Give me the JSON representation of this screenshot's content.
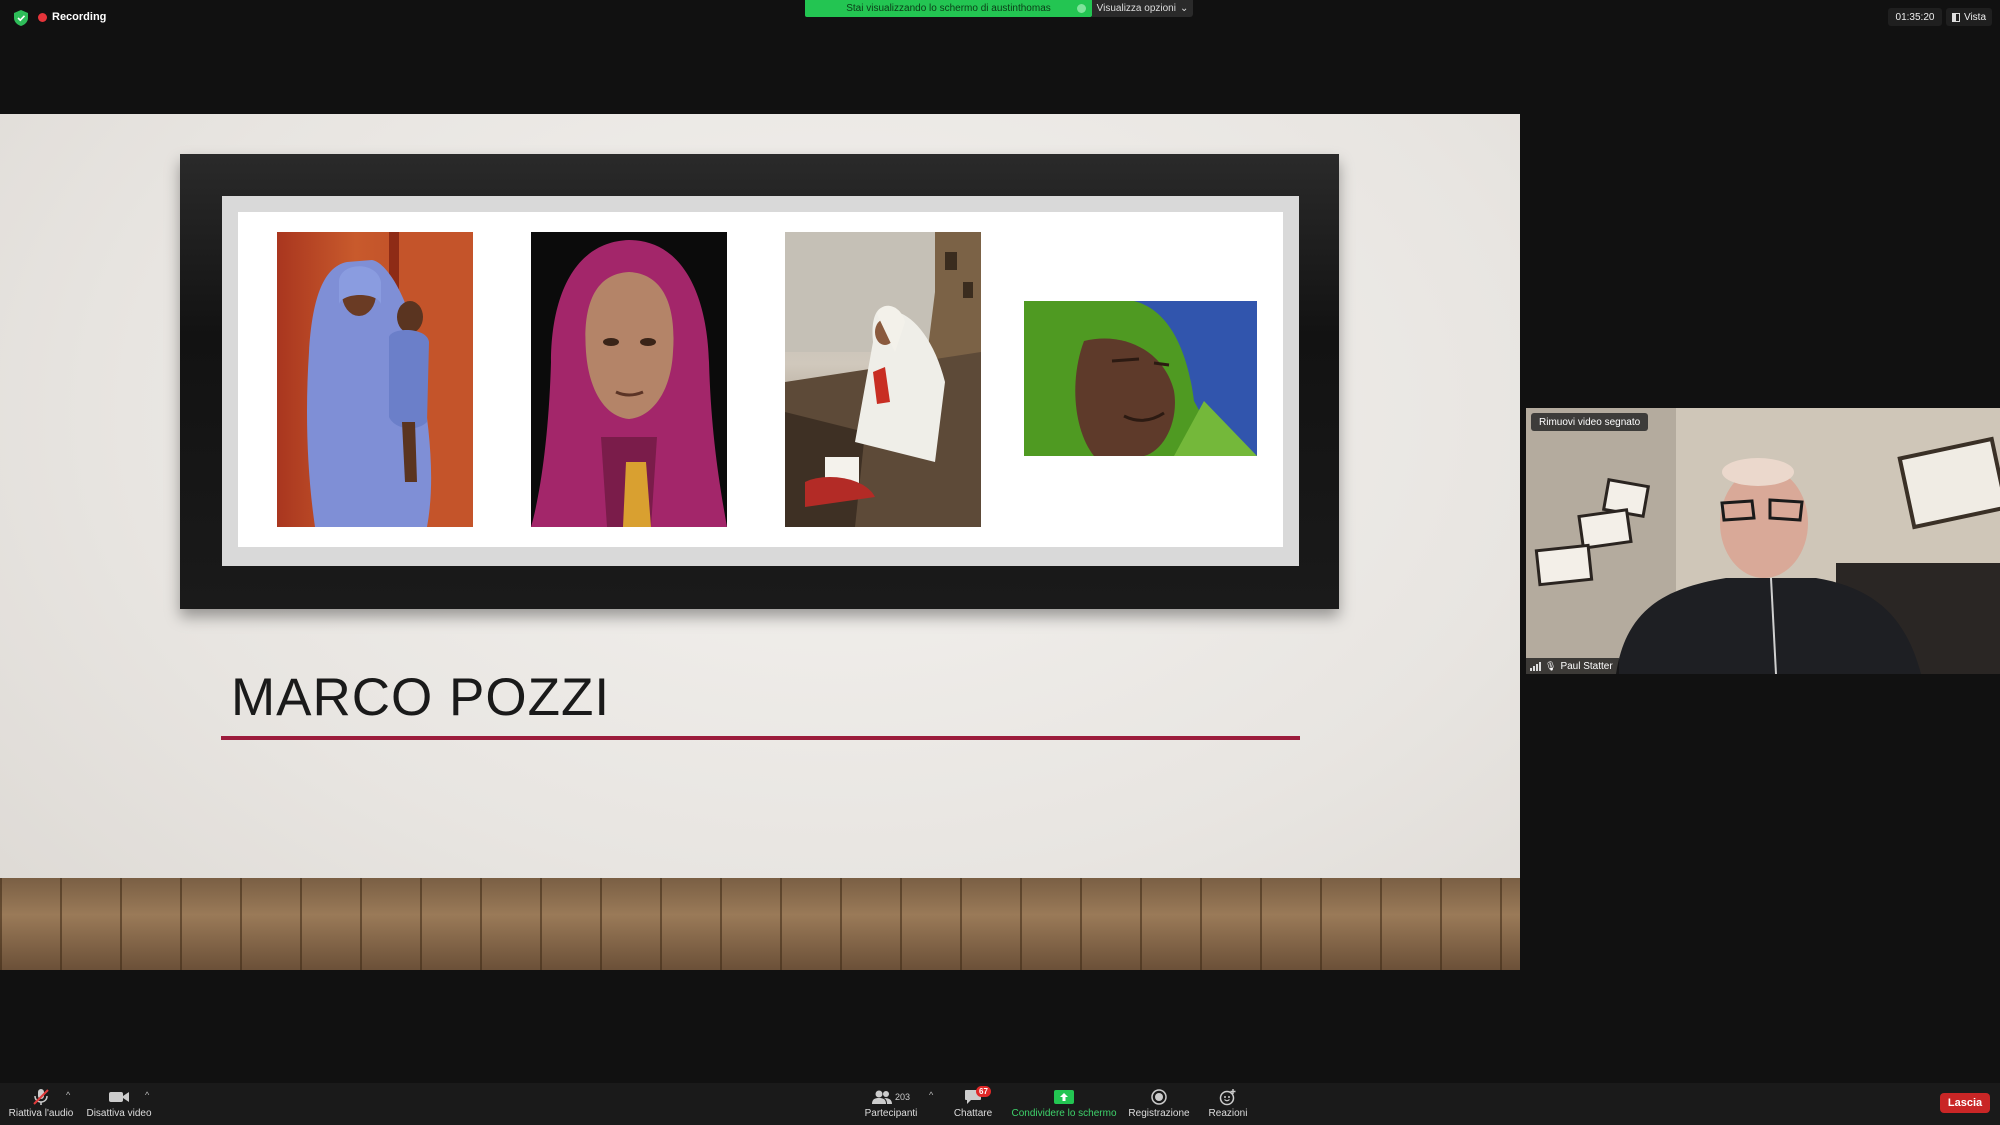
{
  "topbar": {
    "recording_label": "Recording",
    "share_banner": "Stai visualizzando lo schermo di austinthomas",
    "view_options_label": "Visualizza opzioni",
    "clock": "01:35:20",
    "view_label": "Vista"
  },
  "slide": {
    "title": "MARCO POZZI",
    "accent_color": "#9c1c3c"
  },
  "participant": {
    "remove_video_label": "Rimuovi video segnato",
    "name": "Paul Statter"
  },
  "toolbar": {
    "unmute_label": "Riattiva l'audio",
    "stop_video_label": "Disattiva video",
    "participants_label": "Partecipanti",
    "participants_count": "203",
    "chat_label": "Chattare",
    "chat_badge": "67",
    "share_label": "Condividere lo schermo",
    "record_label": "Registrazione",
    "reactions_label": "Reazioni",
    "leave_label": "Lascia"
  },
  "colors": {
    "share_green": "#23c552",
    "recording_red": "#e5343a",
    "leave_red": "#c92626"
  }
}
